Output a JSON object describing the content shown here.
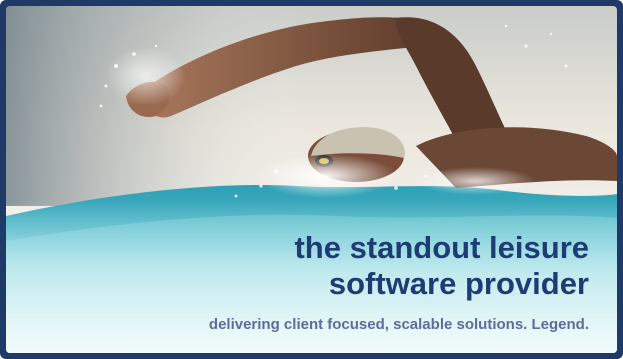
{
  "hero": {
    "headline_line1": "the standout leisure",
    "headline_line2": "software provider",
    "tagline": "delivering client focused, scalable solutions. Legend.",
    "image_subject": "swimmer-photo"
  },
  "colors": {
    "frame": "#1f3a66",
    "headline": "#1d3c73",
    "tagline": "#5d6d9c",
    "water": "#3fb9c9"
  }
}
